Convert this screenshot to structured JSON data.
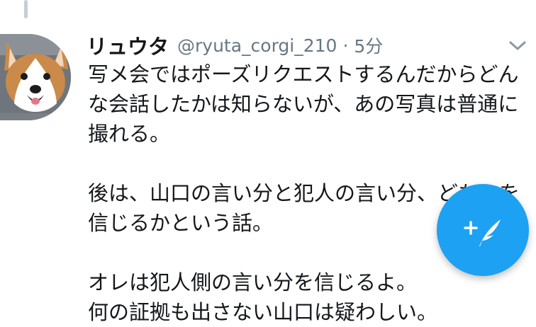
{
  "tweet": {
    "display_name": "リュウタ",
    "handle": "@ryuta_corgi_210",
    "separator": "·",
    "time": "5分",
    "lines": [
      "写メ会ではポーズリクエストするんだからどん",
      "な会話したかは知らないが、あの写真は普通に",
      "撮れる。",
      "",
      "後は、山口の言い分と犯人の言い分、どちらを",
      "信じるかという話。",
      "",
      "オレは犯人側の言い分を信じるよ。",
      "何の証拠も出さない山口は疑わしい。"
    ]
  },
  "icons": {
    "avatar": "corgi-dog-avatar",
    "caret": "chevron-down-icon",
    "fab": "compose-tweet-icon"
  },
  "colors": {
    "accent": "#1da1f2",
    "text": "#14171a",
    "secondary_text": "#657786",
    "thread_line": "#c4cfd6"
  }
}
